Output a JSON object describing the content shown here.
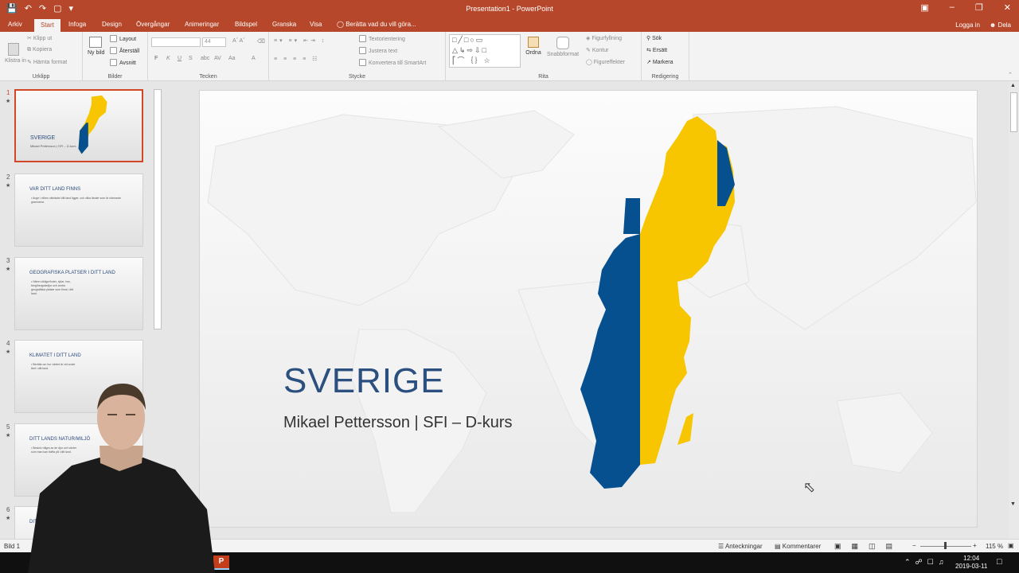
{
  "app": {
    "title": "Presentation1 - PowerPoint"
  },
  "tabs": [
    "Arkiv",
    "Start",
    "Infoga",
    "Design",
    "Övergångar",
    "Animeringar",
    "Bildspel",
    "Granska",
    "Visa"
  ],
  "active_tab": "Start",
  "tell_me": "Berätta vad du vill göra...",
  "account": {
    "login": "Logga in",
    "share": "Dela"
  },
  "ribbon": {
    "clipboard": {
      "label": "Urklipp",
      "paste": "Klistra in",
      "cut": "Klipp ut",
      "copy": "Kopiera",
      "format_painter": "Hämta format"
    },
    "slides": {
      "label": "Bilder",
      "new_slide": "Ny bild",
      "layout": "Layout",
      "reset": "Återställ",
      "section": "Avsnitt"
    },
    "font": {
      "label": "Tecken",
      "size": "44",
      "bold": "F",
      "italic": "K",
      "underline": "U",
      "strike": "S",
      "spacing": "AV",
      "case": "Aa",
      "color": "A"
    },
    "paragraph": {
      "label": "Stycke",
      "text_direction": "Textorientering",
      "align_text": "Justera text",
      "smartart": "Konvertera till SmartArt"
    },
    "drawing": {
      "label": "Rita",
      "arrange": "Ordna",
      "quick_styles": "Snabbformat",
      "fill": "Figurfyllning",
      "outline": "Kontur",
      "effects": "Figureffekter"
    },
    "editing": {
      "label": "Redigering",
      "find": "Sök",
      "replace": "Ersätt",
      "select": "Markera"
    }
  },
  "thumbnails": [
    {
      "num": "1",
      "title": "SVERIGE",
      "body": "Mikael Pettersson | SFI – D-kurs"
    },
    {
      "num": "2",
      "title": "VAR DITT LAND FINNS",
      "body": "• Ange i vilken världsdel ditt land ligger, och vilka länder som är närmaste grannarna."
    },
    {
      "num": "3",
      "title": "GEOGRAFISKA PLATSER I DITT LAND",
      "body": "• Nämn viktiga floder, sjöar, hav, berg/bergskedjor och andra geografiska platser som finns i ditt land."
    },
    {
      "num": "4",
      "title": "KLIMATET I DITT LAND",
      "body": "• Berätta om hur vädret är vid under året i ditt land."
    },
    {
      "num": "5",
      "title": "DITT LANDS NATUR/MILJÖ",
      "body": "• Beskriv några av de djur och växter som man kan träffa på i ditt land."
    },
    {
      "num": "6",
      "title": "DITT",
      "body": ""
    }
  ],
  "slide": {
    "title": "SVERIGE",
    "subtitle": "Mikael Pettersson | SFI – D-kurs"
  },
  "flag_colors": {
    "blue": "#07508f",
    "yellow": "#f7c600"
  },
  "status": {
    "slide_info": "Bild 1",
    "notes": "Anteckningar",
    "comments": "Kommentarer",
    "zoom": "115 %"
  },
  "taskbar": {
    "time": "12:04",
    "date": "2019-03-11",
    "app_icon": "powerpoint-icon"
  }
}
